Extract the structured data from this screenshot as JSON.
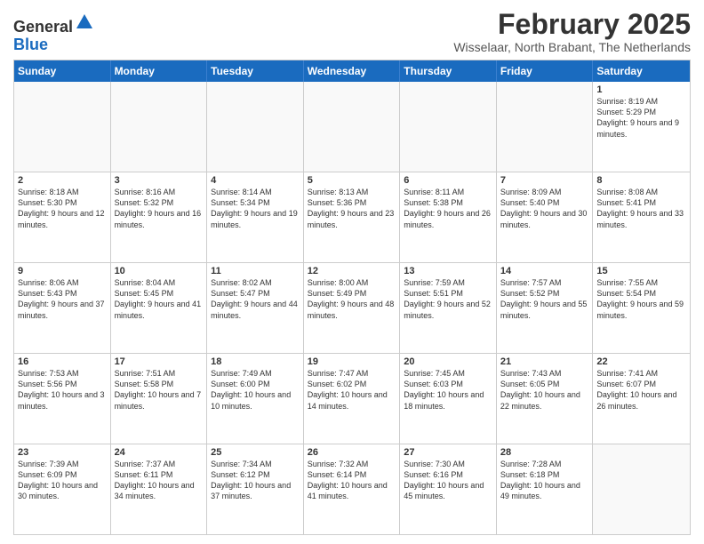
{
  "logo": {
    "general": "General",
    "blue": "Blue"
  },
  "title": "February 2025",
  "location": "Wisselaar, North Brabant, The Netherlands",
  "weekdays": [
    "Sunday",
    "Monday",
    "Tuesday",
    "Wednesday",
    "Thursday",
    "Friday",
    "Saturday"
  ],
  "weeks": [
    [
      {
        "day": "",
        "empty": true
      },
      {
        "day": "",
        "empty": true
      },
      {
        "day": "",
        "empty": true
      },
      {
        "day": "",
        "empty": true
      },
      {
        "day": "",
        "empty": true
      },
      {
        "day": "",
        "empty": true
      },
      {
        "day": "1",
        "sunrise": "8:19 AM",
        "sunset": "5:29 PM",
        "daylight": "9 hours and 9 minutes."
      }
    ],
    [
      {
        "day": "2",
        "sunrise": "8:18 AM",
        "sunset": "5:30 PM",
        "daylight": "9 hours and 12 minutes."
      },
      {
        "day": "3",
        "sunrise": "8:16 AM",
        "sunset": "5:32 PM",
        "daylight": "9 hours and 16 minutes."
      },
      {
        "day": "4",
        "sunrise": "8:14 AM",
        "sunset": "5:34 PM",
        "daylight": "9 hours and 19 minutes."
      },
      {
        "day": "5",
        "sunrise": "8:13 AM",
        "sunset": "5:36 PM",
        "daylight": "9 hours and 23 minutes."
      },
      {
        "day": "6",
        "sunrise": "8:11 AM",
        "sunset": "5:38 PM",
        "daylight": "9 hours and 26 minutes."
      },
      {
        "day": "7",
        "sunrise": "8:09 AM",
        "sunset": "5:40 PM",
        "daylight": "9 hours and 30 minutes."
      },
      {
        "day": "8",
        "sunrise": "8:08 AM",
        "sunset": "5:41 PM",
        "daylight": "9 hours and 33 minutes."
      }
    ],
    [
      {
        "day": "9",
        "sunrise": "8:06 AM",
        "sunset": "5:43 PM",
        "daylight": "9 hours and 37 minutes."
      },
      {
        "day": "10",
        "sunrise": "8:04 AM",
        "sunset": "5:45 PM",
        "daylight": "9 hours and 41 minutes."
      },
      {
        "day": "11",
        "sunrise": "8:02 AM",
        "sunset": "5:47 PM",
        "daylight": "9 hours and 44 minutes."
      },
      {
        "day": "12",
        "sunrise": "8:00 AM",
        "sunset": "5:49 PM",
        "daylight": "9 hours and 48 minutes."
      },
      {
        "day": "13",
        "sunrise": "7:59 AM",
        "sunset": "5:51 PM",
        "daylight": "9 hours and 52 minutes."
      },
      {
        "day": "14",
        "sunrise": "7:57 AM",
        "sunset": "5:52 PM",
        "daylight": "9 hours and 55 minutes."
      },
      {
        "day": "15",
        "sunrise": "7:55 AM",
        "sunset": "5:54 PM",
        "daylight": "9 hours and 59 minutes."
      }
    ],
    [
      {
        "day": "16",
        "sunrise": "7:53 AM",
        "sunset": "5:56 PM",
        "daylight": "10 hours and 3 minutes."
      },
      {
        "day": "17",
        "sunrise": "7:51 AM",
        "sunset": "5:58 PM",
        "daylight": "10 hours and 7 minutes."
      },
      {
        "day": "18",
        "sunrise": "7:49 AM",
        "sunset": "6:00 PM",
        "daylight": "10 hours and 10 minutes."
      },
      {
        "day": "19",
        "sunrise": "7:47 AM",
        "sunset": "6:02 PM",
        "daylight": "10 hours and 14 minutes."
      },
      {
        "day": "20",
        "sunrise": "7:45 AM",
        "sunset": "6:03 PM",
        "daylight": "10 hours and 18 minutes."
      },
      {
        "day": "21",
        "sunrise": "7:43 AM",
        "sunset": "6:05 PM",
        "daylight": "10 hours and 22 minutes."
      },
      {
        "day": "22",
        "sunrise": "7:41 AM",
        "sunset": "6:07 PM",
        "daylight": "10 hours and 26 minutes."
      }
    ],
    [
      {
        "day": "23",
        "sunrise": "7:39 AM",
        "sunset": "6:09 PM",
        "daylight": "10 hours and 30 minutes."
      },
      {
        "day": "24",
        "sunrise": "7:37 AM",
        "sunset": "6:11 PM",
        "daylight": "10 hours and 34 minutes."
      },
      {
        "day": "25",
        "sunrise": "7:34 AM",
        "sunset": "6:12 PM",
        "daylight": "10 hours and 37 minutes."
      },
      {
        "day": "26",
        "sunrise": "7:32 AM",
        "sunset": "6:14 PM",
        "daylight": "10 hours and 41 minutes."
      },
      {
        "day": "27",
        "sunrise": "7:30 AM",
        "sunset": "6:16 PM",
        "daylight": "10 hours and 45 minutes."
      },
      {
        "day": "28",
        "sunrise": "7:28 AM",
        "sunset": "6:18 PM",
        "daylight": "10 hours and 49 minutes."
      },
      {
        "day": "",
        "empty": true
      }
    ]
  ]
}
